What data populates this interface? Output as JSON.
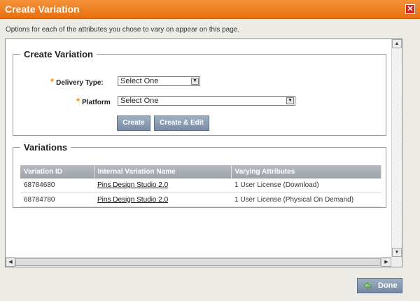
{
  "window": {
    "title": "Create Variation",
    "close_label": "✕"
  },
  "intro_text": "Options for each of the attributes you chose to vary on appear on this page.",
  "create_section": {
    "legend": "Create Variation",
    "delivery_type": {
      "required_mark": "*",
      "label": "Delivery Type:",
      "value": "Select One"
    },
    "platform": {
      "required_mark": "*",
      "label": "Platform",
      "value": "Select One"
    },
    "create_button": "Create",
    "create_edit_button": "Create & Edit"
  },
  "variations_section": {
    "legend": "Variations",
    "columns": [
      "Variation ID",
      "Internal Variation Name",
      "Varying Attributes"
    ],
    "rows": [
      {
        "id": "68784680",
        "name": "Pins Design Studio 2.0",
        "attributes": "1 User License (Download)"
      },
      {
        "id": "68784780",
        "name": "Pins Design Studio 2.0",
        "attributes": "1 User License (Physical On Demand)"
      }
    ]
  },
  "done_button": "Done",
  "colors": {
    "titlebar": "#ef7f20",
    "accent_required": "#f29100",
    "button": "#8a9bb0"
  }
}
